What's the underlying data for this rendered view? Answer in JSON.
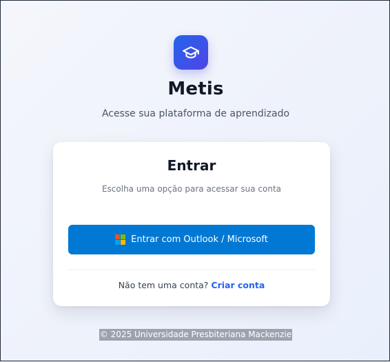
{
  "brand": {
    "title": "Metis",
    "subtitle": "Acesse sua plataforma de aprendizado",
    "logo_icon": "graduation-cap-icon",
    "accent_color": "#4f46e5"
  },
  "card": {
    "title": "Entrar",
    "subtitle": "Escolha uma opção para acessar sua conta",
    "microsoft_button_label": "Entrar com Outlook / Microsoft",
    "microsoft_button_color": "#0078d4",
    "microsoft_icon": "microsoft-logo-icon",
    "microsoft_icon_colors": [
      "#f25022",
      "#7fba00",
      "#00a4ef",
      "#ffb900"
    ],
    "signup_prompt": "Não tem uma conta?",
    "signup_link": "Criar conta",
    "link_color": "#2563eb"
  },
  "footer": {
    "text": "© 2025 Universidade Presbiteriana Mackenzie"
  }
}
